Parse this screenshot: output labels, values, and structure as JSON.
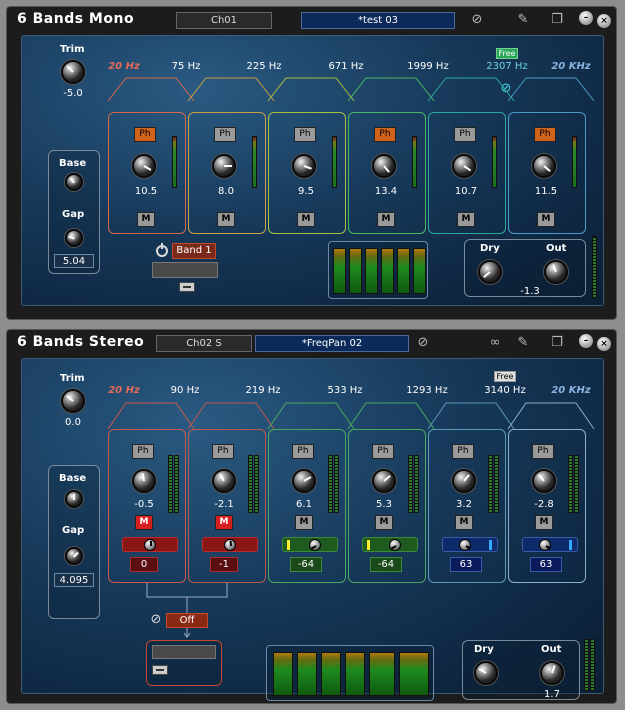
{
  "mono": {
    "title": "6 Bands Mono",
    "channel": "Ch01",
    "preset": "*test 03",
    "trim_label": "Trim",
    "trim_value": "-5.0",
    "freq_low": "20 Hz",
    "freq_high": "20 KHz",
    "crossovers": [
      "75 Hz",
      "225 Hz",
      "671 Hz",
      "1999 Hz",
      "2307 Hz"
    ],
    "free_label": "Free",
    "base_label": "Base",
    "gap_label": "Gap",
    "gap_value": "5.04",
    "bands": [
      {
        "ph": "Ph",
        "ph_active": true,
        "value": "10.5",
        "m": "M"
      },
      {
        "ph": "Ph",
        "ph_active": false,
        "value": "8.0",
        "m": "M"
      },
      {
        "ph": "Ph",
        "ph_active": false,
        "value": "9.5",
        "m": "M"
      },
      {
        "ph": "Ph",
        "ph_active": true,
        "value": "13.4",
        "m": "M"
      },
      {
        "ph": "Ph",
        "ph_active": false,
        "value": "10.7",
        "m": "M"
      },
      {
        "ph": "Ph",
        "ph_active": true,
        "value": "11.5",
        "m": "M"
      }
    ],
    "band_select": "Band 1",
    "dry_label": "Dry",
    "out_label": "Out",
    "out_value": "-1.3",
    "band_colors": [
      "#d4694a",
      "#c8a045",
      "#a8c040",
      "#48b860",
      "#2aa8a0",
      "#4a9ac8"
    ]
  },
  "stereo": {
    "title": "6 Bands Stereo",
    "channel": "Ch02 S",
    "preset": "*FreqPan 02",
    "trim_label": "Trim",
    "trim_value": "0.0",
    "freq_low": "20 Hz",
    "freq_high": "20 KHz",
    "crossovers": [
      "90 Hz",
      "219 Hz",
      "533 Hz",
      "1293 Hz",
      "3140 Hz"
    ],
    "free_label": "Free",
    "base_label": "Base",
    "gap_label": "Gap",
    "gap_value": "4.095",
    "bands": [
      {
        "ph": "Ph",
        "value": "-0.5",
        "m": "M",
        "m_active": true,
        "pan": "0"
      },
      {
        "ph": "Ph",
        "value": "-2.1",
        "m": "M",
        "m_active": true,
        "pan": "-1"
      },
      {
        "ph": "Ph",
        "value": "6.1",
        "m": "M",
        "m_active": false,
        "pan": "-64"
      },
      {
        "ph": "Ph",
        "value": "5.3",
        "m": "M",
        "m_active": false,
        "pan": "-64"
      },
      {
        "ph": "Ph",
        "value": "3.2",
        "m": "M",
        "m_active": false,
        "pan": "63"
      },
      {
        "ph": "Ph",
        "value": "-2.8",
        "m": "M",
        "m_active": false,
        "pan": "63"
      }
    ],
    "off_label": "Off",
    "dry_label": "Dry",
    "out_label": "Out",
    "out_value": "1.7",
    "band_colors": [
      "#c85a4a",
      "#b85a4a",
      "#48a860",
      "#48a860",
      "#5a9ab8",
      "#8ab0c8"
    ]
  }
}
